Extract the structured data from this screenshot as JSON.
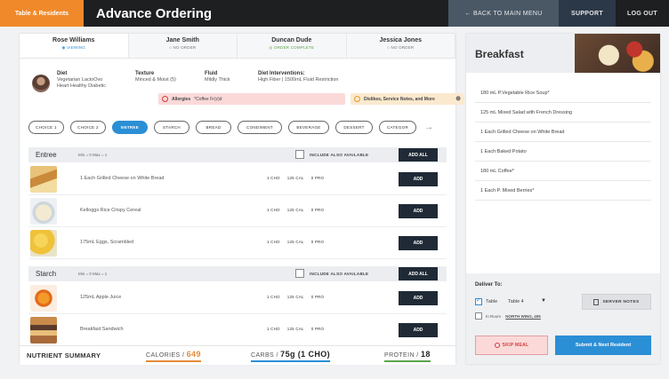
{
  "topbar": {
    "brand_tab": "Table & Residents",
    "title": "Advance Ordering",
    "back_label": "← BACK TO MAIN MENU",
    "support_label": "SUPPORT",
    "logout_label": "LOG OUT"
  },
  "residents": [
    {
      "name": "Rose Williams",
      "status": "◉ VIEWING"
    },
    {
      "name": "Jane Smith",
      "status": "○ NO ORDER"
    },
    {
      "name": "Duncan Dude",
      "status": "◎ ORDER COMPLETE"
    },
    {
      "name": "Jessica Jones",
      "status": "○ NO ORDER"
    }
  ],
  "diet": {
    "diet_label": "Diet",
    "diet_value_1": "Vegetarian LactoOvo",
    "diet_value_2": "Heart Healthy Diabetic",
    "texture_label": "Texture",
    "texture_value": "Minced & Moist (5)",
    "fluid_label": "Fluid",
    "fluid_value": "Mildly Thick",
    "interventions_label": "Diet Interventions:",
    "interventions_value": "High Fiber | 1500mL Fluid Restriction",
    "allergies_label": "Allergies",
    "allergies_value": "*Coffee Fr(z)d",
    "dislikes_label": "Dislikes, Service Notes, and More"
  },
  "categories": {
    "items": [
      "CHOICE 1",
      "CHOICE 2",
      "ENTREE",
      "STARCH",
      "BREAD",
      "CONDIMENT",
      "BEVERAGE",
      "DESSERT",
      "CATEGOR"
    ],
    "arrow": "→"
  },
  "sections": [
    {
      "name": "Entree",
      "minmax": "Min = 0    Max = 1",
      "include_label": "INCLUDE ALSO AVAILABLE",
      "add_all": "ADD ALL"
    },
    {
      "name": "Starch",
      "minmax": "Min = 0    Max = 1",
      "include_label": "INCLUDE ALSO AVAILABLE",
      "add_all": "ADD ALL"
    }
  ],
  "items": [
    {
      "name": "1 Each Grilled Cheese on White Bread",
      "cho": "1 CHO",
      "cal": "125 CAL",
      "pro": "0 PRO",
      "add": "ADD"
    },
    {
      "name": "Kelloggs Rice Crispy Cereal",
      "cho": "1 CHO",
      "cal": "125 CAL",
      "pro": "0 PRO",
      "add": "ADD"
    },
    {
      "name": "175mL Eggs, Scrambled",
      "cho": "1 CHO",
      "cal": "125 CAL",
      "pro": "0 PRO",
      "add": "ADD"
    },
    {
      "name": "125mL Apple Juice",
      "cho": "1 CHO",
      "cal": "125 CAL",
      "pro": "0 PRO",
      "add": "ADD"
    },
    {
      "name": "Breakfast Sandwich",
      "cho": "1 CHO",
      "cal": "125 CAL",
      "pro": "0 PRO",
      "add": "ADD"
    }
  ],
  "nutrient_summary": {
    "title": "NUTRIENT SUMMARY",
    "calories_label": "CALORIES /",
    "calories_value": "649",
    "carbs_label": "CARBS /",
    "carbs_value": "75g (1 CHO)",
    "protein_label": "PROTEIN /",
    "protein_value": "18"
  },
  "breakfast": {
    "title": "Breakfast",
    "orders": [
      "180 mL P.Vegetable Rice Soup*",
      "125 mL Mixed Salad with French Dressing",
      "1 Each Grilled Cheese on White Bread",
      "1 Each Baked Potato",
      "180 mL Coffee*",
      "1 Each P. Mixed Berries*"
    ]
  },
  "deliver": {
    "title": "Deliver To:",
    "table_label": "Table",
    "table_value": "Table 4",
    "room_label": "In Room",
    "room_value": "NORTH WING, 405",
    "server_notes": "SERVER NOTES",
    "skip_meal": "SKIP MEAL",
    "submit": "Submit & Next Resident"
  },
  "colors": {
    "brand_orange": "#f0892a",
    "accent_blue": "#2b8fd6",
    "dark_button": "#1f2a36",
    "allergy_red": "#d23b3b"
  }
}
